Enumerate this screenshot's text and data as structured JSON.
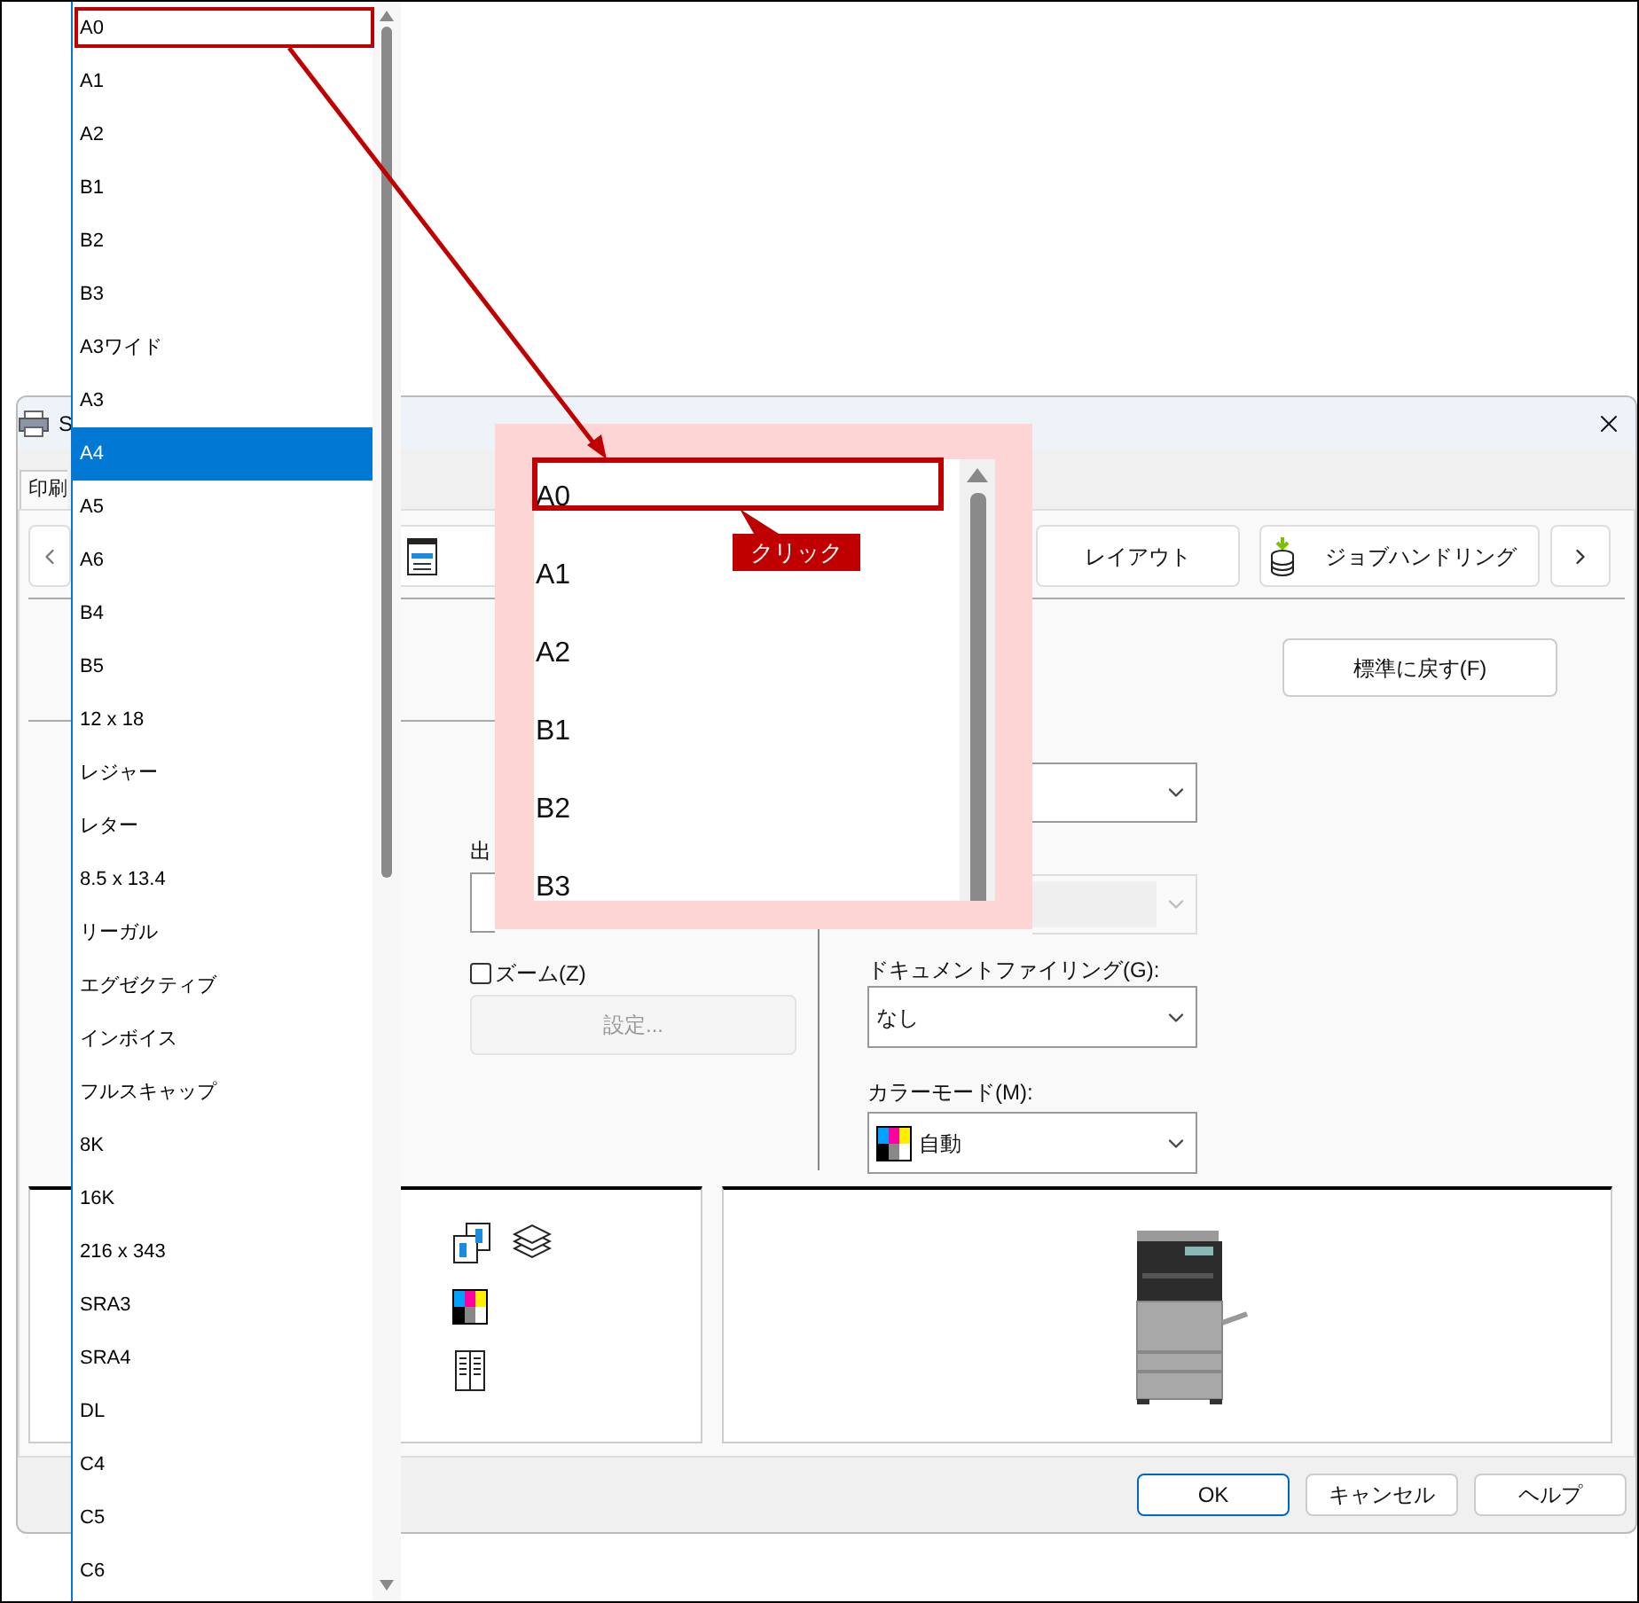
{
  "dialog": {
    "title": "S",
    "tab": "印刷",
    "toolbar": {
      "buttons": [
        "レイアウト",
        "ジョブハンドリング"
      ]
    },
    "reset_button": "標準に戻す(F)",
    "output": {
      "label": "出"
    },
    "top_select": {
      "disabled": false
    },
    "second_select": {
      "disabled": true
    },
    "zoom": {
      "label": "ズーム(Z)",
      "checked": false
    },
    "settings_button": {
      "label": "設定...",
      "disabled": true
    },
    "document_filing": {
      "label": "ドキュメントファイリング(G):",
      "value": "なし"
    },
    "color_mode": {
      "label": "カラーモード(M):",
      "value": "自動"
    },
    "footer_buttons": [
      {
        "label": "OK",
        "default": true
      },
      {
        "label": "キャンセル",
        "default": false
      },
      {
        "label": "ヘルプ",
        "default": false
      }
    ]
  },
  "paper_list": {
    "items": [
      {
        "label": "A0",
        "selected": false
      },
      {
        "label": "A1",
        "selected": false
      },
      {
        "label": "A2",
        "selected": false
      },
      {
        "label": "B1",
        "selected": false
      },
      {
        "label": "B2",
        "selected": false
      },
      {
        "label": "B3",
        "selected": false
      },
      {
        "label": "A3ワイド",
        "selected": false
      },
      {
        "label": "A3",
        "selected": false
      },
      {
        "label": "A4",
        "selected": true
      },
      {
        "label": "A5",
        "selected": false
      },
      {
        "label": "A6",
        "selected": false
      },
      {
        "label": "B4",
        "selected": false
      },
      {
        "label": "B5",
        "selected": false
      },
      {
        "label": "12 x 18",
        "selected": false
      },
      {
        "label": "レジャー",
        "selected": false
      },
      {
        "label": "レター",
        "selected": false
      },
      {
        "label": "8.5 x 13.4",
        "selected": false
      },
      {
        "label": "リーガル",
        "selected": false
      },
      {
        "label": "エグゼクティブ",
        "selected": false
      },
      {
        "label": "インボイス",
        "selected": false
      },
      {
        "label": "フルスキャップ",
        "selected": false
      },
      {
        "label": "8K",
        "selected": false
      },
      {
        "label": "16K",
        "selected": false
      },
      {
        "label": "216 x 343",
        "selected": false
      },
      {
        "label": "SRA3",
        "selected": false
      },
      {
        "label": "SRA4",
        "selected": false
      },
      {
        "label": "DL",
        "selected": false
      },
      {
        "label": "C4",
        "selected": false
      },
      {
        "label": "C5",
        "selected": false
      },
      {
        "label": "C6",
        "selected": false
      }
    ]
  },
  "zoom_inset": {
    "items": [
      "A0",
      "A1",
      "A2",
      "B1",
      "B2",
      "B3"
    ],
    "callout": "クリック"
  }
}
